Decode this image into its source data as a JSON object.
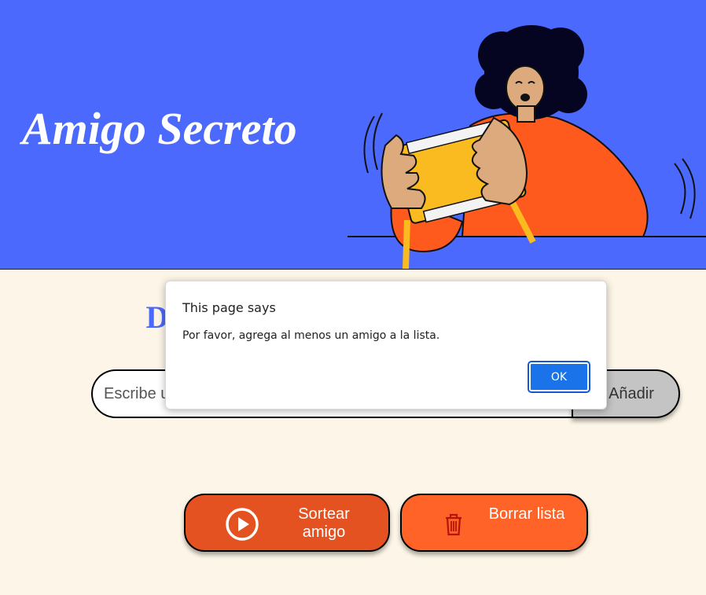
{
  "header": {
    "title": "Amigo Secreto",
    "background_color": "#4b69fd"
  },
  "main": {
    "section_title": "Digite el nombre de sus amigos",
    "input": {
      "value": "",
      "placeholder": "Escribe un nombre"
    },
    "add_label": "Añadir",
    "draw_label": "Sortear amigo",
    "draw_icon": "play-circle-icon",
    "clear_label": "Borrar lista",
    "clear_icon": "trash-icon"
  },
  "dialog": {
    "title": "This page says",
    "message": "Por favor, agrega al menos un amigo a la lista.",
    "ok_label": "OK"
  },
  "colors": {
    "accent": "#4b69fd",
    "draw_button": "#e35220",
    "clear_button": "#ff6328",
    "page_background": "#fdf6e8"
  }
}
